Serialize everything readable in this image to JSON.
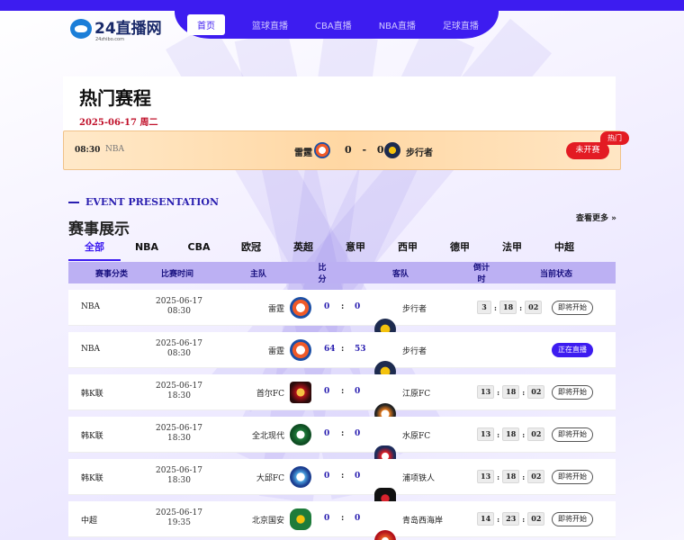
{
  "brand": {
    "name": "24直播网",
    "sub": "24zhibo.com"
  },
  "nav": [
    "首页",
    "篮球直播",
    "CBA直播",
    "NBA直播",
    "足球直播"
  ],
  "hot": {
    "title": "热门赛程",
    "date": "2025-06-17 周二",
    "match": {
      "time": "08:30",
      "league": "NBA",
      "home": "雷霆",
      "score": "0 - 0",
      "away": "步行者",
      "status": "未开赛",
      "badge": "热门"
    }
  },
  "events": {
    "eng_title": "EVENT PRESENTATION",
    "title": "赛事展示",
    "more": "查看更多",
    "tabs": [
      "全部",
      "NBA",
      "CBA",
      "欧冠",
      "英超",
      "意甲",
      "西甲",
      "德甲",
      "法甲",
      "中超"
    ],
    "columns": [
      "赛事分类",
      "比赛时间",
      "主队",
      "比分",
      "客队",
      "倒计时",
      "当前状态"
    ],
    "rows": [
      {
        "league": "NBA",
        "date": "2025-06-17",
        "time": "08:30",
        "home": "雷霆",
        "hs": "0",
        "as": "0",
        "away": "步行者",
        "cd": [
          "3",
          "18",
          "02"
        ],
        "status": "即将开始",
        "live": false
      },
      {
        "league": "NBA",
        "date": "2025-06-17",
        "time": "08:30",
        "home": "雷霆",
        "hs": "64",
        "as": "53",
        "away": "步行者",
        "cd": null,
        "status": "正在直播",
        "live": true
      },
      {
        "league": "韩K联",
        "date": "2025-06-17",
        "time": "18:30",
        "home": "首尔FC",
        "hs": "0",
        "as": "0",
        "away": "江原FC",
        "cd": [
          "13",
          "18",
          "02"
        ],
        "status": "即将开始",
        "live": false
      },
      {
        "league": "韩K联",
        "date": "2025-06-17",
        "time": "18:30",
        "home": "全北现代",
        "hs": "0",
        "as": "0",
        "away": "水原FC",
        "cd": [
          "13",
          "18",
          "02"
        ],
        "status": "即将开始",
        "live": false
      },
      {
        "league": "韩K联",
        "date": "2025-06-17",
        "time": "18:30",
        "home": "大邱FC",
        "hs": "0",
        "as": "0",
        "away": "浦项铁人",
        "cd": [
          "13",
          "18",
          "02"
        ],
        "status": "即将开始",
        "live": false
      },
      {
        "league": "中超",
        "date": "2025-06-17",
        "time": "19:35",
        "home": "北京国安",
        "hs": "0",
        "as": "0",
        "away": "青岛西海岸",
        "cd": [
          "14",
          "23",
          "02"
        ],
        "status": "即将开始",
        "live": false
      }
    ]
  },
  "colors": {
    "primary": "#3d1cf0",
    "accent": "#e31b23",
    "header_row": "#bcb0f3"
  }
}
